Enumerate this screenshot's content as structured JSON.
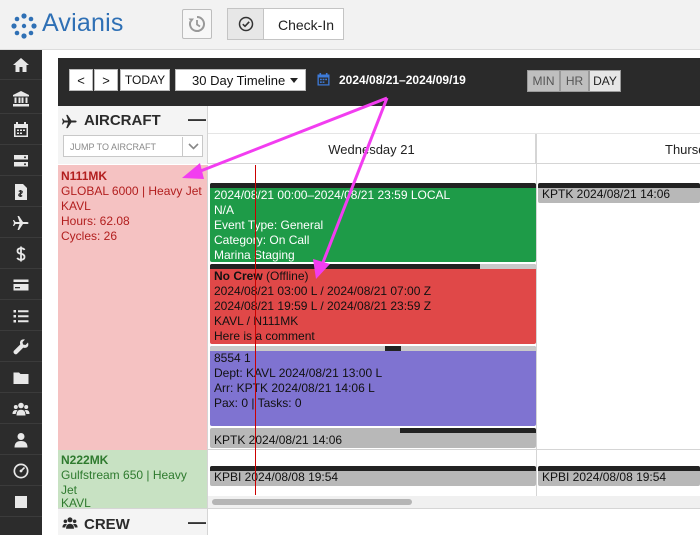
{
  "app": {
    "name": "Avianis"
  },
  "topbar": {
    "checkin_label": "Check-In"
  },
  "toolbar": {
    "today_label": "TODAY",
    "prev_label": "<",
    "next_label": ">",
    "timeline_label": "30 Day Timeline",
    "date_range": "2024/08/21–2024/09/19",
    "zoom": [
      "MIN",
      "HR",
      "DAY"
    ],
    "zoom_selected": "DAY"
  },
  "aircraft_panel": {
    "title": "AIRCRAFT",
    "collapse": "—",
    "jump_placeholder": "JUMP TO AIRCRAFT"
  },
  "days": [
    "Wednesday 21",
    "Thursd"
  ],
  "aircraft": [
    {
      "tail": "N111MK",
      "type": "GLOBAL 6000 | Heavy Jet",
      "base": "KAVL",
      "hours": "Hours: 62.08",
      "cycles": "Cycles: 26"
    },
    {
      "tail": "N222MK",
      "type_line1": "Gulfstream 650 | Heavy",
      "type_line2": "Jet",
      "base": "KAVL"
    }
  ],
  "events": {
    "event1": {
      "line1": "2024/08/21 00:00–2024/08/21 23:59 LOCAL",
      "line2": "N/A",
      "line3": "Event Type: General",
      "line4": "Category: On Call",
      "line5": "Marina Staging",
      "color": "#1e9b48"
    },
    "event2": {
      "title": "No Crew",
      "status": "(Offline)",
      "line2": "2024/08/21 03:00 L / 2024/08/21 07:00 Z",
      "line3": "2024/08/21 19:59 L / 2024/08/21 23:59 Z",
      "line4": "KAVL / N111MK",
      "line5": "Here is a comment",
      "color": "#e04848"
    },
    "event3": {
      "line1": "8554 1",
      "line2": "Dept: KAVL 2024/08/21 13:00 L",
      "line3": "Arr: KPTK 2024/08/21 14:06 L",
      "line4": "Pax: 0 | Tasks: 0",
      "color": "#7f73d1"
    },
    "position1": "KPTK 2024/08/21 14:06",
    "position2": "KPTK 2024/08/21 14:06",
    "position3": "KPBI 2024/08/08 19:54",
    "position4": "KPBI 2024/08/08 19:54"
  },
  "crew_panel": {
    "title": "CREW",
    "collapse": "—"
  },
  "colors": {
    "accent": "#2f70b5",
    "annotation": "#f23df0",
    "now_line": "#cc0000"
  }
}
